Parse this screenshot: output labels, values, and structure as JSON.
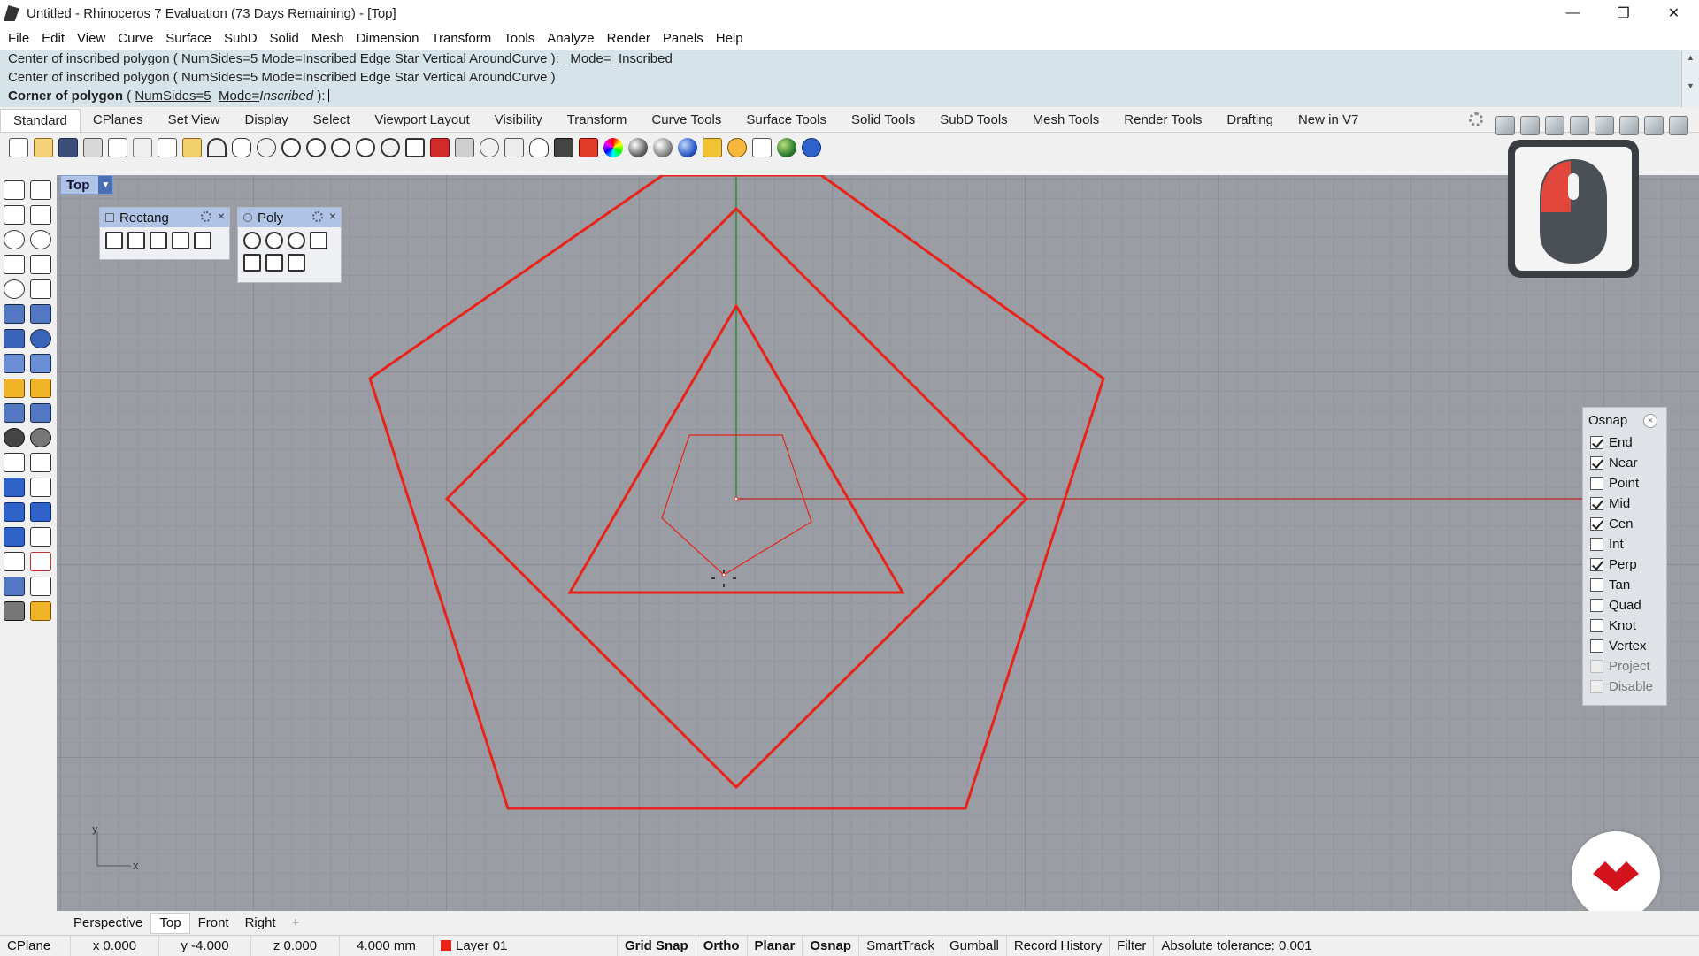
{
  "window": {
    "title": "Untitled - Rhinoceros 7 Evaluation (73 Days Remaining) - [Top]",
    "minimize": "—",
    "maximize": "❐",
    "close": "✕"
  },
  "menu": [
    "File",
    "Edit",
    "View",
    "Curve",
    "Surface",
    "SubD",
    "Solid",
    "Mesh",
    "Dimension",
    "Transform",
    "Tools",
    "Analyze",
    "Render",
    "Panels",
    "Help"
  ],
  "command": {
    "history": [
      "Center of inscribed polygon ( NumSides=5  Mode=Inscribed  Edge  Star  Vertical  AroundCurve ): _Mode=_Inscribed",
      "Center of inscribed polygon ( NumSides=5  Mode=Inscribed  Edge  Star  Vertical  AroundCurve )"
    ],
    "prompt_label": "Corner of polygon",
    "prompt_open": " ( ",
    "prompt_numsides": "NumSides=5",
    "prompt_mode_key": "Mode=",
    "prompt_mode_val": "Inscribed",
    "prompt_close": " ):",
    "scroll_up": "▲",
    "scroll_down": "▼"
  },
  "tabs": [
    "Standard",
    "CPlanes",
    "Set View",
    "Display",
    "Select",
    "Viewport Layout",
    "Visibility",
    "Transform",
    "Curve Tools",
    "Surface Tools",
    "Solid Tools",
    "SubD Tools",
    "Mesh Tools",
    "Render Tools",
    "Drafting",
    "New in V7"
  ],
  "active_tab": "Standard",
  "viewport": {
    "name": "Top",
    "dropdown": "▼",
    "axis_x": "x",
    "axis_y": "y",
    "curve_color": "#e8231a"
  },
  "panels": {
    "rectangle": {
      "title": "Rectang",
      "close": "×"
    },
    "polygon": {
      "title": "Poly",
      "close": "×"
    }
  },
  "osnap": {
    "title": "Osnap",
    "close": "×",
    "items": [
      {
        "label": "End",
        "checked": true,
        "enabled": true
      },
      {
        "label": "Near",
        "checked": true,
        "enabled": true
      },
      {
        "label": "Point",
        "checked": false,
        "enabled": true
      },
      {
        "label": "Mid",
        "checked": true,
        "enabled": true
      },
      {
        "label": "Cen",
        "checked": true,
        "enabled": true
      },
      {
        "label": "Int",
        "checked": false,
        "enabled": true
      },
      {
        "label": "Perp",
        "checked": true,
        "enabled": true
      },
      {
        "label": "Tan",
        "checked": false,
        "enabled": true
      },
      {
        "label": "Quad",
        "checked": false,
        "enabled": true
      },
      {
        "label": "Knot",
        "checked": false,
        "enabled": true
      },
      {
        "label": "Vertex",
        "checked": false,
        "enabled": true
      },
      {
        "label": "Project",
        "checked": false,
        "enabled": false
      },
      {
        "label": "Disable",
        "checked": false,
        "enabled": false
      }
    ]
  },
  "viewport_tabs": [
    "Perspective",
    "Top",
    "Front",
    "Right"
  ],
  "active_viewport_tab": "Top",
  "add_viewport_tab": "+",
  "status": {
    "cplane": "CPlane",
    "x": "x 0.000",
    "y": "y -4.000",
    "z": "z 0.000",
    "distance": "4.000 mm",
    "layer": "Layer 01",
    "layer_color": "#e8231a",
    "grid_snap": "Grid Snap",
    "ortho": "Ortho",
    "planar": "Planar",
    "osnap": "Osnap",
    "smarttrack": "SmartTrack",
    "gumball": "Gumball",
    "record_history": "Record History",
    "filter": "Filter",
    "tolerance": "Absolute tolerance: 0.001"
  },
  "colors": {
    "accent": "#aec3e6",
    "curve": "#e8231a",
    "command_bg": "#d6e4ea",
    "badge": "#d4141c"
  }
}
